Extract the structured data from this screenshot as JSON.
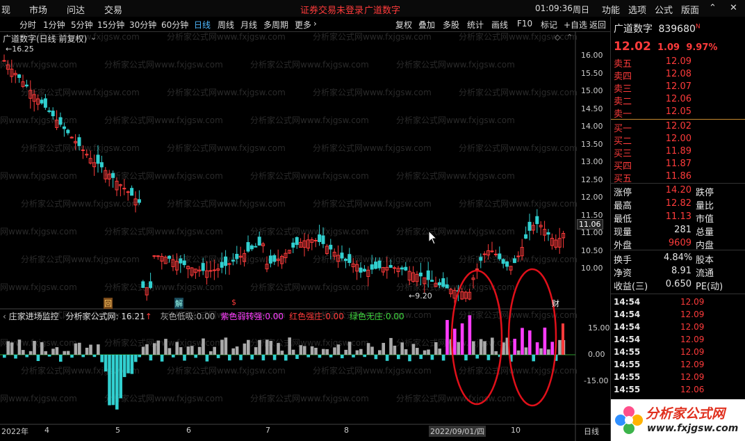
{
  "menubar": {
    "items": [
      "现",
      "市场",
      "问达",
      "交易"
    ],
    "login_notice": "证券交易未登录",
    "stock_name": "广道数字",
    "clock": "01:09:36",
    "weekday": "周日",
    "right_items": [
      "功能",
      "选项",
      "公式",
      "版面"
    ]
  },
  "tabs": [
    "分时",
    "1分钟",
    "5分钟",
    "15分钟",
    "30分钟",
    "60分钟",
    "日线",
    "周线",
    "月线",
    "多周期",
    "更多"
  ],
  "tools": [
    "复权",
    "叠加",
    "多股",
    "统计",
    "画线",
    "F10",
    "标记",
    "+自选",
    "返回"
  ],
  "chart": {
    "title": "广道数字(日线 前复权)",
    "price_high_label": "16.25",
    "price_low_label": "9.20",
    "current_price_label": "11.06",
    "price_ticks": [
      "16.00",
      "15.50",
      "15.00",
      "14.50",
      "14.00",
      "13.50",
      "13.00",
      "12.50",
      "12.00",
      "11.50",
      "11.00",
      "10.50",
      "10.00"
    ],
    "markers": [
      "回",
      "解",
      "$",
      "财"
    ],
    "sub_title": "庄家进场监控",
    "sub_formula_label": "分析家公式网:",
    "sub_formula_value": "16.21",
    "sub_items": [
      {
        "label": "灰色低吸:",
        "value": "0.00",
        "color": "#aaaaaa"
      },
      {
        "label": "紫色弱转强:",
        "value": "0.00",
        "color": "#ff3cff"
      },
      {
        "label": "红色强庄:",
        "value": "0.00",
        "color": "#ff3b3b"
      },
      {
        "label": "绿色无庄:",
        "value": "0.00",
        "color": "#3bd43b"
      }
    ],
    "sub_ticks": [
      "15.00",
      "0.00",
      "-15.00"
    ],
    "dates": [
      "2022年",
      "4",
      "5",
      "6",
      "7",
      "8",
      "2022/09/01/四",
      "10"
    ],
    "period_label": "日线",
    "watermark": "分析家公式网www.fxjgsw.com"
  },
  "quote": {
    "name": "广道数字",
    "code": "839680",
    "flag": "N",
    "price": "12.02",
    "change": "1.09",
    "change_pct": "9.97%",
    "asks": [
      {
        "label": "卖五",
        "price": "12.09"
      },
      {
        "label": "卖四",
        "price": "12.08"
      },
      {
        "label": "卖三",
        "price": "12.07"
      },
      {
        "label": "卖二",
        "price": "12.06"
      },
      {
        "label": "卖一",
        "price": "12.05"
      }
    ],
    "bids": [
      {
        "label": "买一",
        "price": "12.02"
      },
      {
        "label": "买二",
        "price": "12.00"
      },
      {
        "label": "买三",
        "price": "11.89"
      },
      {
        "label": "买四",
        "price": "11.87"
      },
      {
        "label": "买五",
        "price": "11.86"
      }
    ],
    "stats": [
      {
        "label": "涨停",
        "value": "14.20",
        "label2": "跌停"
      },
      {
        "label": "最高",
        "value": "12.82",
        "label2": "量比"
      },
      {
        "label": "最低",
        "value": "11.13",
        "label2": "市值"
      },
      {
        "label": "现量",
        "value": "281",
        "label2": "总量"
      },
      {
        "label": "外盘",
        "value": "9609",
        "label2": "内盘"
      }
    ],
    "stats2": [
      {
        "label": "换手",
        "value": "4.84%",
        "label2": "股本"
      },
      {
        "label": "净资",
        "value": "8.91",
        "label2": "流通"
      },
      {
        "label": "收益(三)",
        "value": "0.650",
        "label2": "PE(动)"
      }
    ],
    "ticks": [
      {
        "time": "14:54",
        "price": "12.09"
      },
      {
        "time": "14:54",
        "price": "12.09"
      },
      {
        "time": "14:54",
        "price": "12.09"
      },
      {
        "time": "14:54",
        "price": "12.09"
      },
      {
        "time": "14:55",
        "price": "12.09"
      },
      {
        "time": "14:55",
        "price": "12.09"
      },
      {
        "time": "14:55",
        "price": "12.09"
      },
      {
        "time": "14:55",
        "price": "12.06"
      }
    ],
    "logo_text": "分析家公式网",
    "logo_url": "www.fxjgsw.com"
  },
  "colors": {
    "up": "#ff3b3b",
    "down": "#31d0d0",
    "purple": "#ff3cff",
    "gray": "#aaaaaa",
    "active_tab": "#4fb8ff"
  }
}
